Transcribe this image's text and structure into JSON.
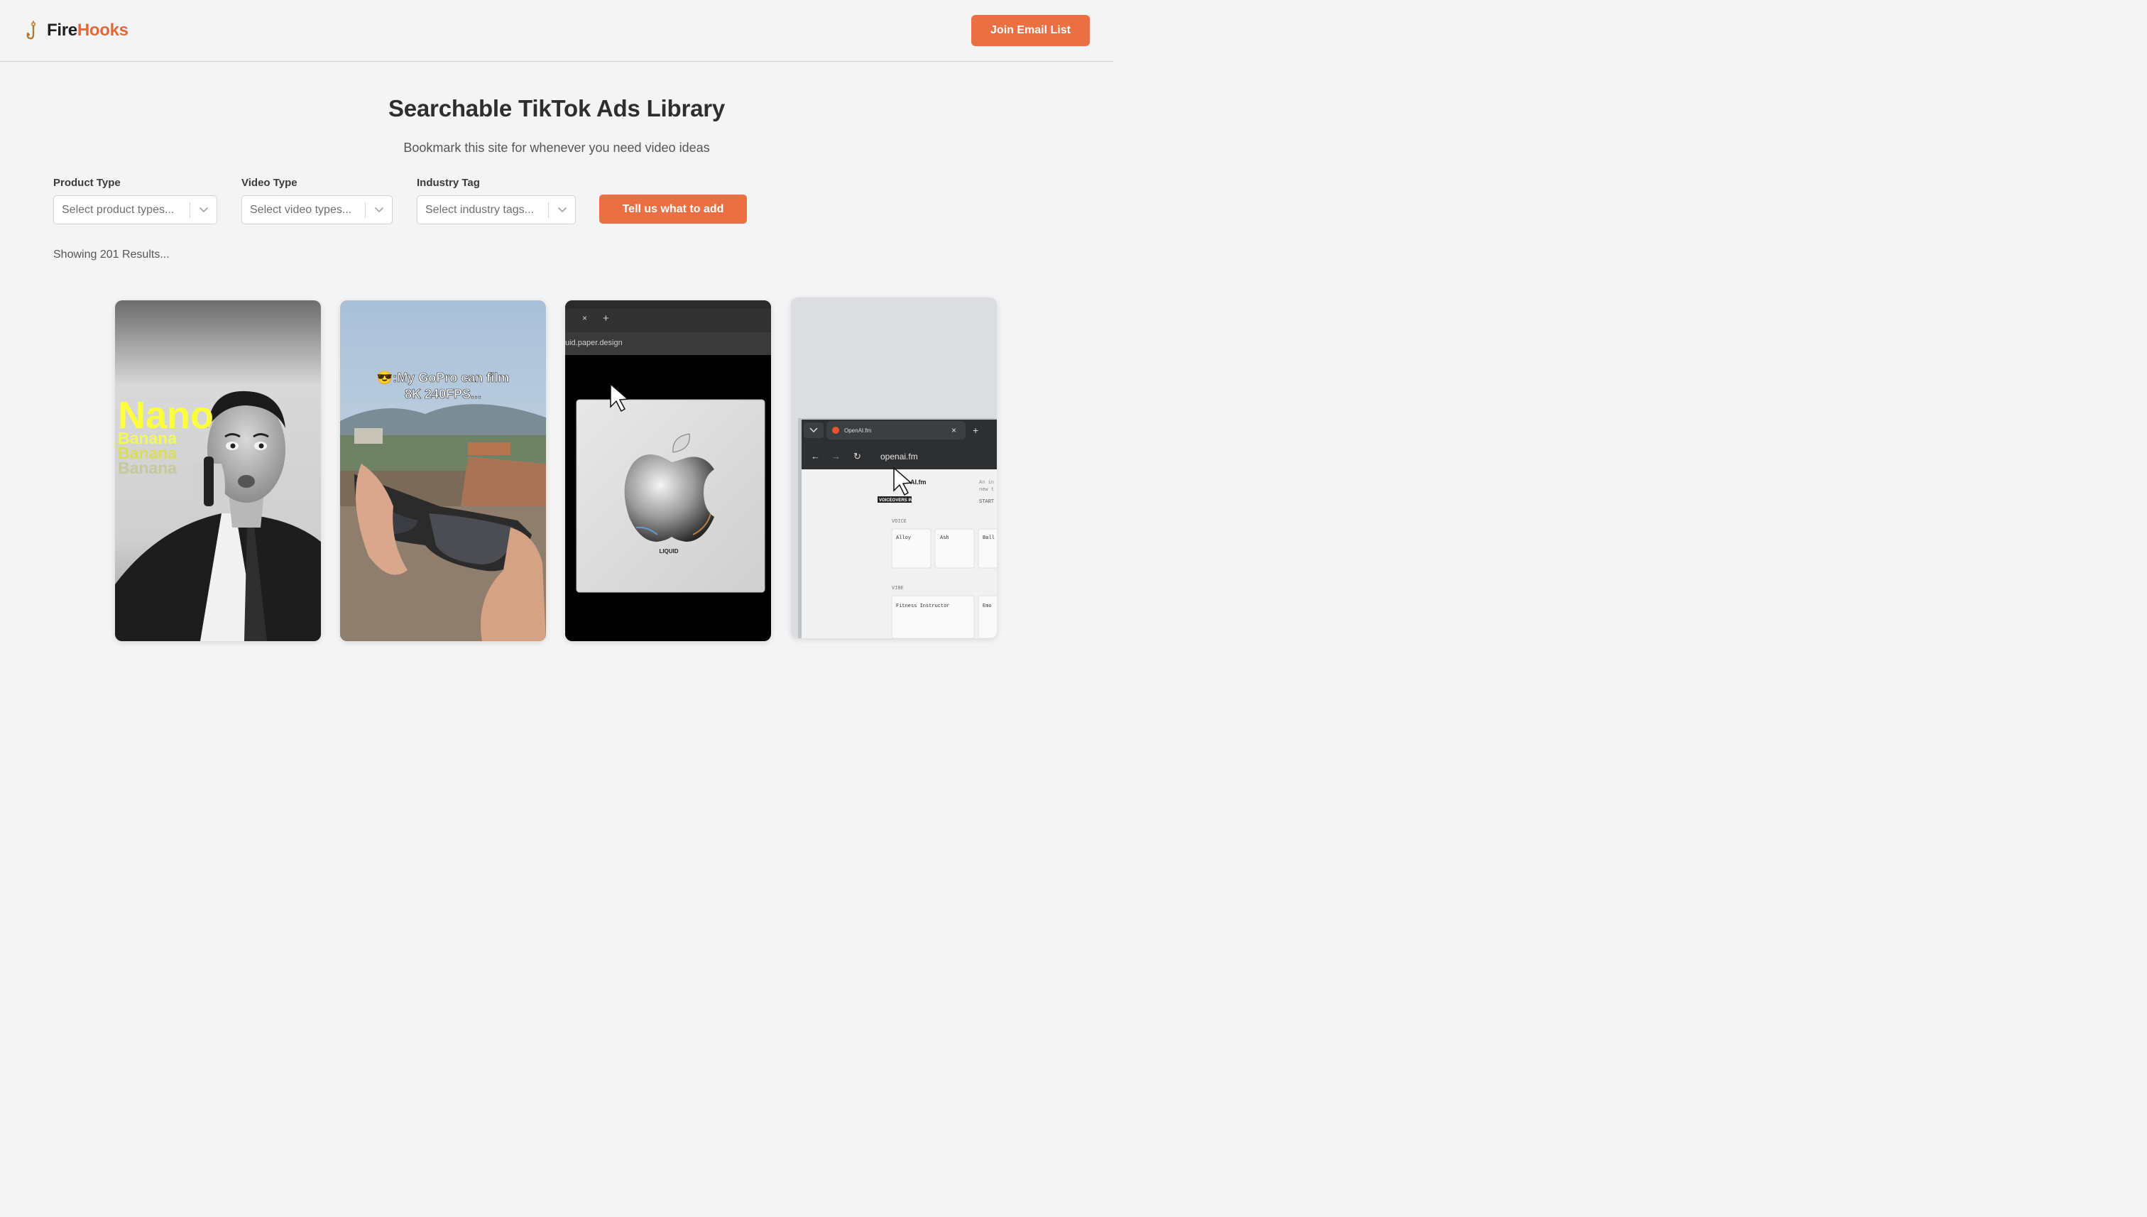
{
  "header": {
    "brand_first": "Fire",
    "brand_second": "Hooks",
    "join_label": "Join Email List"
  },
  "hero": {
    "title": "Searchable TikTok Ads Library",
    "subtitle": "Bookmark this site for whenever you need video ideas"
  },
  "filters": [
    {
      "label": "Product Type",
      "placeholder": "Select product types..."
    },
    {
      "label": "Video Type",
      "placeholder": "Select video types..."
    },
    {
      "label": "Industry Tag",
      "placeholder": "Select industry tags..."
    }
  ],
  "tell_label": "Tell us what to add",
  "results_text": "Showing 201 Results...",
  "cards": [
    {
      "texts": [
        "Nano",
        "Banana",
        "Banana",
        "Banana"
      ]
    },
    {
      "texts": [
        "😎:My GoPro can film",
        "8K 240FPS..."
      ]
    },
    {
      "texts": [
        "uid.paper.design",
        "LIQUID"
      ]
    },
    {
      "texts": [
        "OpenAI.fm",
        "openai.fm",
        "AI.fm",
        "VOICEOVERS IN",
        "An in",
        "new t",
        "START",
        "VOICE",
        "Alloy",
        "Ash",
        "Ball",
        "VIBE",
        "Fitness Instructor",
        "Emo"
      ]
    }
  ],
  "colors": {
    "accent": "#ea7043",
    "background": "#f4f4f4"
  }
}
